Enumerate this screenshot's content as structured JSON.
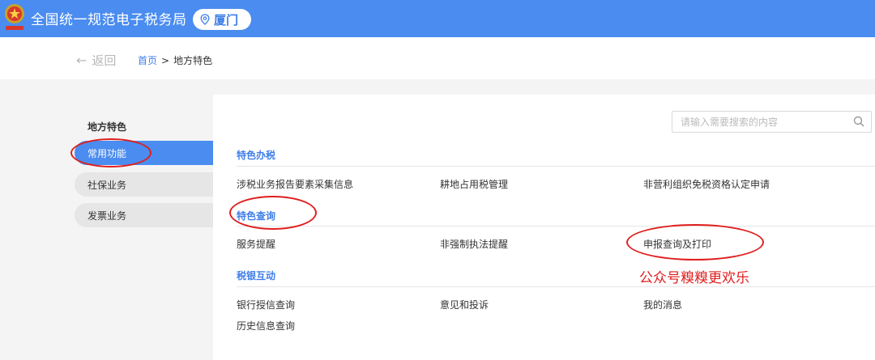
{
  "header": {
    "site_title": "全国统一规范电子税务局",
    "city": "厦门",
    "emblem_icon": "tax-emblem-icon",
    "pin_icon": "location-pin-icon"
  },
  "breadcrumb_bar": {
    "back_label": "返回",
    "back_icon": "arrow-left-icon",
    "home_label": "首页",
    "separator": ">",
    "current_label": "地方特色"
  },
  "sidebar": {
    "heading": "地方特色",
    "items": [
      {
        "label": "常用功能",
        "active": true
      },
      {
        "label": "社保业务",
        "active": false
      },
      {
        "label": "发票业务",
        "active": false
      }
    ]
  },
  "search": {
    "placeholder": "请输入需要搜索的内容",
    "icon": "search-icon"
  },
  "sections": [
    {
      "title": "特色办税",
      "links": [
        "涉税业务报告要素采集信息",
        "耕地占用税管理",
        "非营利组织免税资格认定申请"
      ]
    },
    {
      "title": "特色查询",
      "links": [
        "服务提醒",
        "非强制执法提醒",
        "申报查询及打印"
      ]
    },
    {
      "title": "税银互动",
      "links": [
        "银行授信查询",
        "意见和投诉",
        "我的消息",
        "历史信息查询"
      ]
    }
  ],
  "annotation": {
    "watermark_text": "公众号糗糗更欢乐",
    "color": "#e01e1e"
  },
  "colors": {
    "brand_blue": "#4a8cf0",
    "link_blue": "#3f7ee8"
  }
}
